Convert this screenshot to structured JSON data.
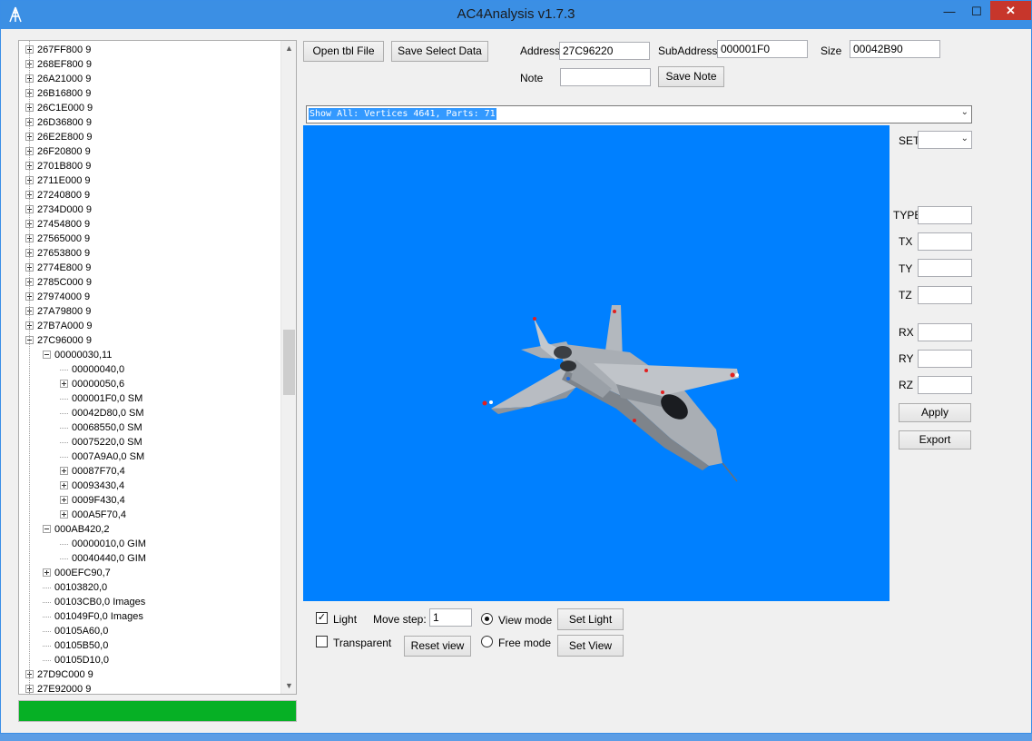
{
  "window": {
    "title": "AC4Analysis v1.7.3",
    "minimize": "—",
    "maximize": "☐",
    "close": "✕"
  },
  "toolbar": {
    "open_label": "Open tbl File",
    "save_select_label": "Save Select Data",
    "address_label": "Address",
    "address_value": "27C96220",
    "subaddress_label": "SubAddress",
    "subaddress_value": "000001F0",
    "size_label": "Size",
    "size_value": "00042B90",
    "note_label": "Note",
    "note_value": "",
    "save_note_label": "Save Note"
  },
  "parts_combo": {
    "selected": "Show All: Vertices 4641, Parts: 71"
  },
  "tree": {
    "items": [
      {
        "label": "267FF800 9",
        "indent": 0,
        "exp": "plus"
      },
      {
        "label": "268EF800 9",
        "indent": 0,
        "exp": "plus"
      },
      {
        "label": "26A21000 9",
        "indent": 0,
        "exp": "plus"
      },
      {
        "label": "26B16800 9",
        "indent": 0,
        "exp": "plus"
      },
      {
        "label": "26C1E000 9",
        "indent": 0,
        "exp": "plus"
      },
      {
        "label": "26D36800 9",
        "indent": 0,
        "exp": "plus"
      },
      {
        "label": "26E2E800 9",
        "indent": 0,
        "exp": "plus"
      },
      {
        "label": "26F20800 9",
        "indent": 0,
        "exp": "plus"
      },
      {
        "label": "2701B800 9",
        "indent": 0,
        "exp": "plus"
      },
      {
        "label": "2711E000 9",
        "indent": 0,
        "exp": "plus"
      },
      {
        "label": "27240800 9",
        "indent": 0,
        "exp": "plus"
      },
      {
        "label": "2734D000 9",
        "indent": 0,
        "exp": "plus"
      },
      {
        "label": "27454800 9",
        "indent": 0,
        "exp": "plus"
      },
      {
        "label": "27565000 9",
        "indent": 0,
        "exp": "plus"
      },
      {
        "label": "27653800 9",
        "indent": 0,
        "exp": "plus"
      },
      {
        "label": "2774E800 9",
        "indent": 0,
        "exp": "plus"
      },
      {
        "label": "2785C000 9",
        "indent": 0,
        "exp": "plus"
      },
      {
        "label": "27974000 9",
        "indent": 0,
        "exp": "plus"
      },
      {
        "label": "27A79800 9",
        "indent": 0,
        "exp": "plus"
      },
      {
        "label": "27B7A000 9",
        "indent": 0,
        "exp": "plus"
      },
      {
        "label": "27C96000 9",
        "indent": 0,
        "exp": "minus"
      },
      {
        "label": "00000030,11",
        "indent": 1,
        "exp": "minus"
      },
      {
        "label": "00000040,0",
        "indent": 2,
        "exp": "none"
      },
      {
        "label": "00000050,6",
        "indent": 2,
        "exp": "plus"
      },
      {
        "label": "000001F0,0 SM",
        "indent": 2,
        "exp": "none"
      },
      {
        "label": "00042D80,0 SM",
        "indent": 2,
        "exp": "none"
      },
      {
        "label": "00068550,0 SM",
        "indent": 2,
        "exp": "none"
      },
      {
        "label": "00075220,0 SM",
        "indent": 2,
        "exp": "none"
      },
      {
        "label": "0007A9A0,0 SM",
        "indent": 2,
        "exp": "none"
      },
      {
        "label": "00087F70,4",
        "indent": 2,
        "exp": "plus"
      },
      {
        "label": "00093430,4",
        "indent": 2,
        "exp": "plus"
      },
      {
        "label": "0009F430,4",
        "indent": 2,
        "exp": "plus"
      },
      {
        "label": "000A5F70,4",
        "indent": 2,
        "exp": "plus"
      },
      {
        "label": "000AB420,2",
        "indent": 1,
        "exp": "minus"
      },
      {
        "label": "00000010,0 GIM",
        "indent": 2,
        "exp": "none"
      },
      {
        "label": "00040440,0 GIM",
        "indent": 2,
        "exp": "none"
      },
      {
        "label": "000EFC90,7",
        "indent": 1,
        "exp": "plus"
      },
      {
        "label": "00103820,0",
        "indent": 1,
        "exp": "none"
      },
      {
        "label": "00103CB0,0 Images",
        "indent": 1,
        "exp": "none"
      },
      {
        "label": "001049F0,0 Images",
        "indent": 1,
        "exp": "none"
      },
      {
        "label": "00105A60,0",
        "indent": 1,
        "exp": "none"
      },
      {
        "label": "00105B50,0",
        "indent": 1,
        "exp": "none"
      },
      {
        "label": "00105D10,0",
        "indent": 1,
        "exp": "none"
      },
      {
        "label": "27D9C000 9",
        "indent": 0,
        "exp": "plus"
      },
      {
        "label": "27E92000 9",
        "indent": 0,
        "exp": "plus"
      }
    ]
  },
  "progress": {
    "fraction": 1.0,
    "color": "#06b025"
  },
  "right_panel": {
    "set_label": "SET",
    "type_label": "TYPE",
    "tx_label": "TX",
    "ty_label": "TY",
    "tz_label": "TZ",
    "rx_label": "RX",
    "ry_label": "RY",
    "rz_label": "RZ",
    "apply_label": "Apply",
    "export_label": "Export"
  },
  "viewport": {
    "background": "#0080ff"
  },
  "bottom": {
    "light_label": "Light",
    "light_checked": true,
    "transparent_label": "Transparent",
    "transparent_checked": false,
    "move_step_label": "Move step:",
    "move_step_value": "1",
    "view_mode_label": "View mode",
    "free_mode_label": "Free mode",
    "reset_view_label": "Reset view",
    "set_light_label": "Set Light",
    "set_view_label": "Set View"
  }
}
